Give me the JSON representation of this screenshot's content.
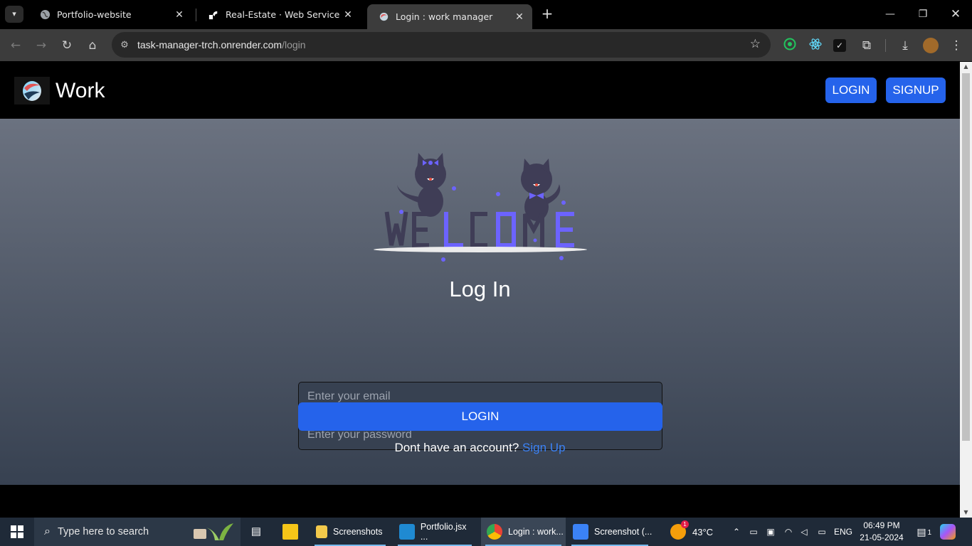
{
  "browser": {
    "tabs": [
      {
        "title": "Portfolio-website",
        "favicon": "globe-icon"
      },
      {
        "title": "Real-Estate · Web Service · Render",
        "favicon": "render-logo-icon"
      },
      {
        "title": "Login : work manager",
        "favicon": "site-logo-icon",
        "active": true
      }
    ],
    "url": {
      "host": "task-manager-trch.onrender.com",
      "path": "/login"
    },
    "tab_menu_icon": "chevron-down-icon",
    "new_tab_label": "+",
    "extensions": [
      "circle-extension-icon",
      "react-devtools-icon",
      "checkbox-extension-icon",
      "puzzle-icon",
      "download-icon",
      "profile-avatar"
    ]
  },
  "site": {
    "brand": "Work",
    "nav": {
      "login": "LOGIN",
      "signup": "SIGNUP"
    },
    "hero": {
      "art_word": "WELCOME",
      "title": "Log In",
      "email_placeholder": "Enter your email",
      "password_placeholder": "Enter your password",
      "submit": "LOGIN",
      "no_account": "Dont have an account?",
      "signup_link": "Sign Up"
    },
    "colors": {
      "accent": "#2563eb",
      "art_purple": "#6c63ff",
      "art_dark": "#3f3d56"
    }
  },
  "taskbar": {
    "search_placeholder": "Type here to search",
    "apps": [
      {
        "label": "Screenshots",
        "icon": "folder-icon"
      },
      {
        "label": "Portfolio.jsx ...",
        "icon": "vscode-icon"
      },
      {
        "label": "Login : work...",
        "icon": "chrome-icon",
        "active": true
      },
      {
        "label": "Screenshot (...",
        "icon": "photos-icon"
      }
    ],
    "weather": "43°C",
    "weather_badge": "1",
    "language": "ENG",
    "time": "06:49 PM",
    "date": "21-05-2024",
    "notification_count": "1"
  }
}
